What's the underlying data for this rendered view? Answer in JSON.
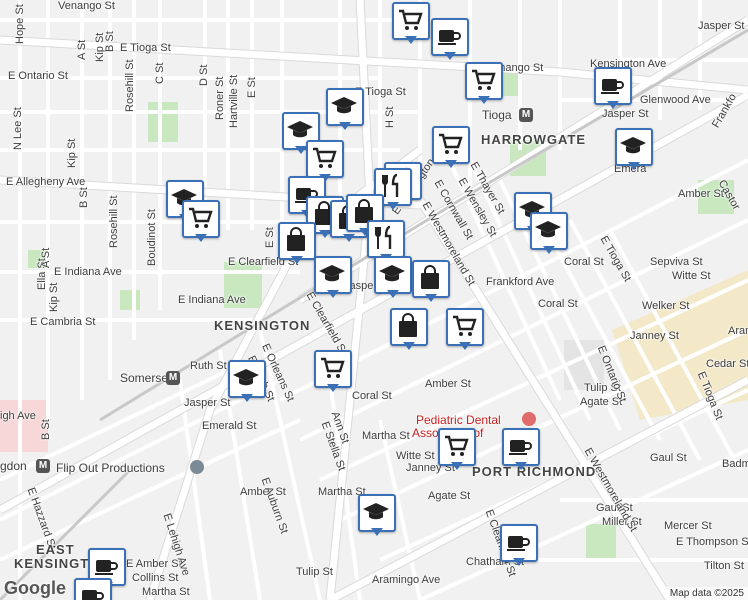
{
  "map": {
    "attribution": "Map data ©2025",
    "logo": "Google",
    "neighborhoods": {
      "kensington": "KENSINGTON",
      "harrowgate": "HARROWGATE",
      "port_richmond": "PORT RICHMOND",
      "east_kensington_1": "EAST",
      "east_kensington_2": "KENSINGTON"
    },
    "transit": {
      "tioga": "Tioga",
      "somerset": "Somerset",
      "huntingdon": "gdon"
    },
    "places": {
      "flip_out": "Flip Out Productions",
      "pediatric_1": "Pediatric Dental",
      "pediatric_2": "Associates of"
    },
    "streets": {
      "e_tioga_1": "E Tioga St",
      "e_tioga_2": "E Tioga St",
      "e_venango_top": "Venango St",
      "e_venango": "E Venango St",
      "e_ontario": "E Ontario St",
      "e_allegheny": "E Allegheny Ave",
      "e_clearfield_1": "E Clearfield St",
      "e_clearfield_2": "E Clearfield St",
      "e_indiana_1": "E Indiana Ave",
      "e_indiana_2": "E Indiana Ave",
      "e_cambria": "E Cambria St",
      "kensington_ave_1": "Kensington Ave",
      "kensington_ave_2": "E Kensington Ave",
      "glenwood": "Glenwood Ave",
      "jasper_1": "Jasper St",
      "jasper_2": "Jasper St",
      "jasper_3": "Jasper St",
      "jasper_4": "Jasper St",
      "frankford_ave": "Frankford Ave",
      "frankford_2": "Frankfo",
      "castor": "Castor",
      "emerald_1": "Emerald St",
      "emerald_2": "Emerald St",
      "amber_1": "Amber St",
      "amber_2": "Amber St",
      "amber_3": "Amber St",
      "amber_4": "Amber St",
      "coral_1": "Coral St",
      "coral_2": "Coral St",
      "coral_3": "Coral St",
      "ruth": "Ruth St",
      "martha_1": "Martha St",
      "martha_2": "Martha St",
      "martha_3": "Martha St",
      "hope": "Hope St",
      "n_lee": "N Lee St",
      "b_st_1": "B St",
      "b_st_2": "B St",
      "b_st_3": "B St",
      "kip_1": "Kip St",
      "kip_2": "Kip St",
      "kip_3": "Kip St",
      "rosehill_1": "Rosehill St",
      "rosehill_2": "Rosehill St",
      "c_st": "C St",
      "d_st": "D St",
      "roner": "Roner St",
      "hartville": "Hartville St",
      "e_st": "E St",
      "boudinot": "Boudinot St",
      "ella": "Ella St",
      "a_st_1": "A St",
      "a_st_2": "A St",
      "e_st_2": "E St",
      "h_st": "H St",
      "e_westmoreland_1": "E Westmoreland St",
      "e_westmoreland_2": "E Westmoreland St",
      "e_cornwall": "E Cornwall St",
      "e_wensley": "E Wensley St",
      "e_thayer": "E Thayer St",
      "e_tioga_3": "E Tioga St",
      "e_tioga_4": "E Tioga St",
      "e_ontario_2": "E Ontario St",
      "e_orleans": "E Orleans St",
      "e_birch": "E Birch St",
      "e_stella": "E Stella St",
      "ann": "Ann St",
      "e_clearfield_3": "E Clearfield St",
      "tulip_1": "Tulip St",
      "tulip_2": "Tulip St",
      "agate_1": "Agate St",
      "agate_2": "Agate St",
      "witte_1": "Witte St",
      "witte_2": "Witte St",
      "janney_1": "Janney St",
      "janney_2": "Janney St",
      "welker": "Welker St",
      "sepviva": "Sepviva St",
      "cedar": "Cedar St",
      "aramingo_1": "Aramingo Ave",
      "aramingo_2": "Arami",
      "e_lehigh": "E Lehigh Ave",
      "e_hazzard": "E Hazzard St",
      "e_auburn": "E Auburn St",
      "collins": "Collins St",
      "chatham": "Chatham St",
      "e_clearfield_4": "E Clearfield St",
      "gaul_1": "Gaul St",
      "gaul_2": "Gaul St",
      "miller": "Miller St",
      "mercer": "Mercer St",
      "e_thompson": "E Thompson St",
      "tilton": "Tilton St",
      "igh_ave": "igh Ave",
      "jasper_top": "Jasper St",
      "e_a": "E A St",
      "richmond_part": "Richmond St",
      "badm": "Badm",
      "emera": "Emera",
      "amber_east": "Amber St",
      "coral_east": "Coral St",
      "witte_east": "Witte St",
      "jasper_s": "Jasper St",
      "e_amber": "E Amber St",
      "kensington_ave_3": "Kensington Ave"
    }
  },
  "markers": [
    {
      "type": "shopping-cart",
      "label": "grocery"
    },
    {
      "type": "coffee",
      "label": "cafe"
    },
    {
      "type": "shopping-cart",
      "label": "grocery"
    },
    {
      "type": "coffee",
      "label": "cafe"
    },
    {
      "type": "school",
      "label": "school"
    },
    {
      "type": "school",
      "label": "school"
    },
    {
      "type": "shopping-cart",
      "label": "grocery"
    },
    {
      "type": "school",
      "label": "school"
    },
    {
      "type": "shopping-cart",
      "label": "grocery"
    },
    {
      "type": "restaurant",
      "label": "restaurant"
    },
    {
      "type": "school",
      "label": "school"
    },
    {
      "type": "coffee",
      "label": "cafe"
    },
    {
      "type": "restaurant",
      "label": "restaurant"
    },
    {
      "type": "shopping-bag",
      "label": "shop"
    },
    {
      "type": "shopping-bag",
      "label": "shop"
    },
    {
      "type": "shopping-bag",
      "label": "shop"
    },
    {
      "type": "shopping-cart",
      "label": "grocery"
    },
    {
      "type": "school",
      "label": "school"
    },
    {
      "type": "shopping-bag",
      "label": "shop"
    },
    {
      "type": "restaurant",
      "label": "restaurant"
    },
    {
      "type": "school",
      "label": "school"
    },
    {
      "type": "school",
      "label": "school"
    },
    {
      "type": "school",
      "label": "school"
    },
    {
      "type": "shopping-bag",
      "label": "shop"
    },
    {
      "type": "shopping-bag",
      "label": "shop"
    },
    {
      "type": "shopping-cart",
      "label": "grocery"
    },
    {
      "type": "school",
      "label": "school"
    },
    {
      "type": "shopping-cart",
      "label": "grocery"
    },
    {
      "type": "shopping-cart",
      "label": "grocery"
    },
    {
      "type": "coffee",
      "label": "cafe"
    },
    {
      "type": "school",
      "label": "school"
    },
    {
      "type": "coffee",
      "label": "cafe"
    },
    {
      "type": "coffee",
      "label": "cafe"
    },
    {
      "type": "coffee",
      "label": "cafe"
    }
  ],
  "colors": {
    "background": "#f1f1f1",
    "road": "#ffffff",
    "road_outline": "#dadada",
    "major_road": "#ffffff",
    "park": "#c9e8c0",
    "industrial": "#f3e9c8",
    "hospital": "#f7d7d7",
    "marker_border": "#3b6fb6",
    "rail": "#c8c8c8"
  }
}
